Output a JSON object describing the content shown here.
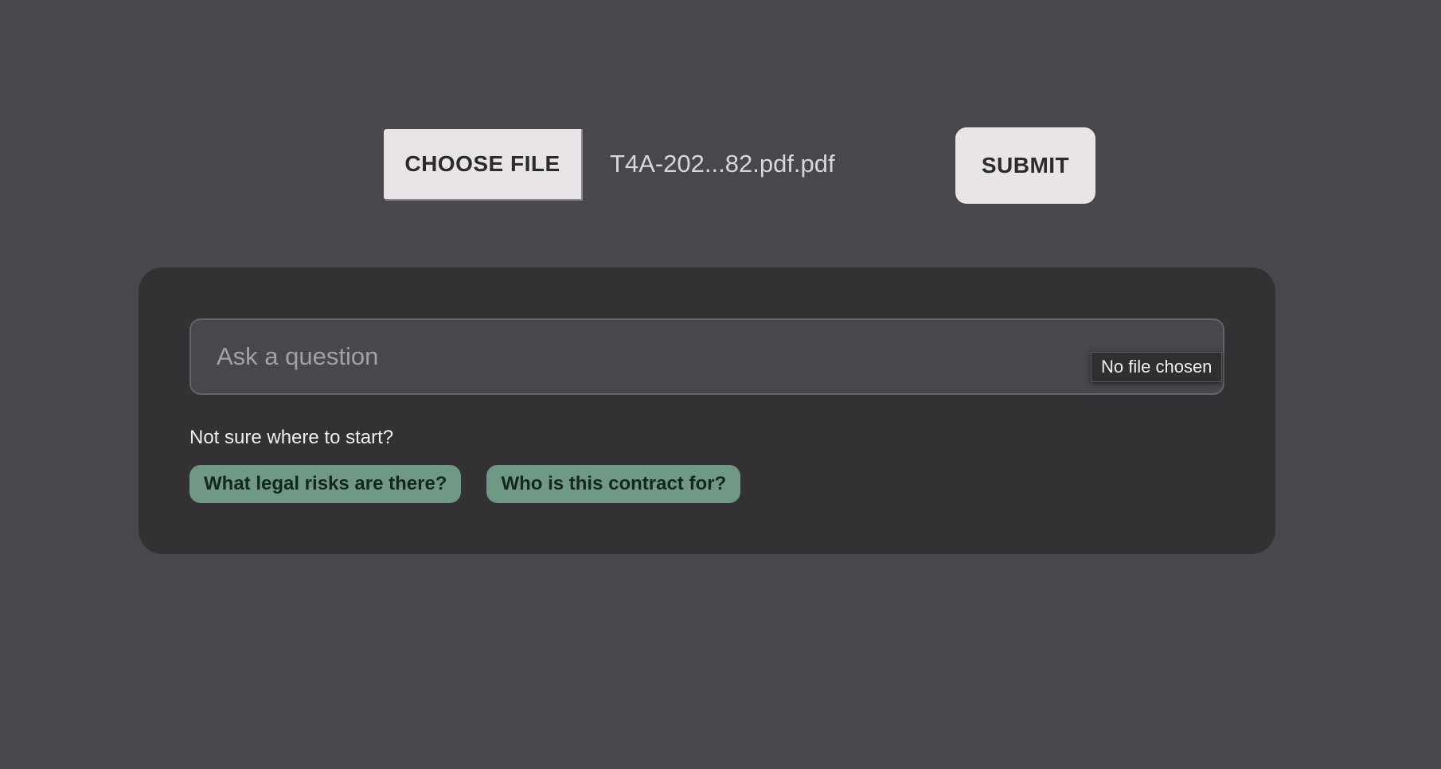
{
  "upload": {
    "choose_file_label": "CHOOSE FILE",
    "file_name": "T4A-202...82.pdf.pdf",
    "submit_label": "SUBMIT"
  },
  "qa": {
    "question_placeholder": "Ask a question",
    "question_value": "",
    "tooltip_text": "No file chosen",
    "start_prompt": "Not sure where to start?",
    "suggestions": [
      {
        "label": "What legal risks are there?"
      },
      {
        "label": "Who is this contract for?"
      }
    ]
  },
  "colors": {
    "page_background": "#49474b",
    "panel_background": "#333134",
    "button_background": "#e8e4e8",
    "chip_background": "#6f9886",
    "chip_text": "#12281e"
  }
}
